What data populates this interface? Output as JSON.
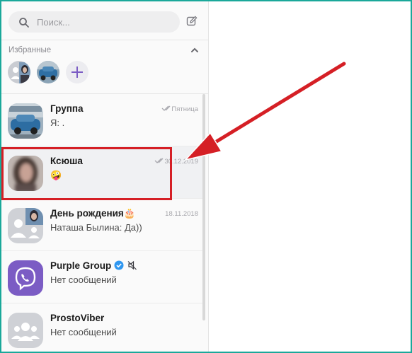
{
  "search": {
    "placeholder": "Поиск..."
  },
  "favorites": {
    "title": "Избранные"
  },
  "chats": [
    {
      "name": "Группа",
      "message": "Я: .",
      "time": "Пятница",
      "ticks": true
    },
    {
      "name": "Ксюша",
      "message": "🤪",
      "time": "30.12.2019",
      "ticks": true
    },
    {
      "name": "День рождения🎂",
      "message": "Наташа Былина: Да))",
      "time": "18.11.2018",
      "ticks": false
    },
    {
      "name": "Purple Group",
      "message": "Нет сообщений",
      "time": "",
      "ticks": false
    },
    {
      "name": "ProstoViber",
      "message": "Нет сообщений",
      "time": "",
      "ticks": false
    }
  ],
  "colors": {
    "accent": "#7b5cc4",
    "frame": "#1aa89a",
    "annotation": "#d51f25"
  }
}
